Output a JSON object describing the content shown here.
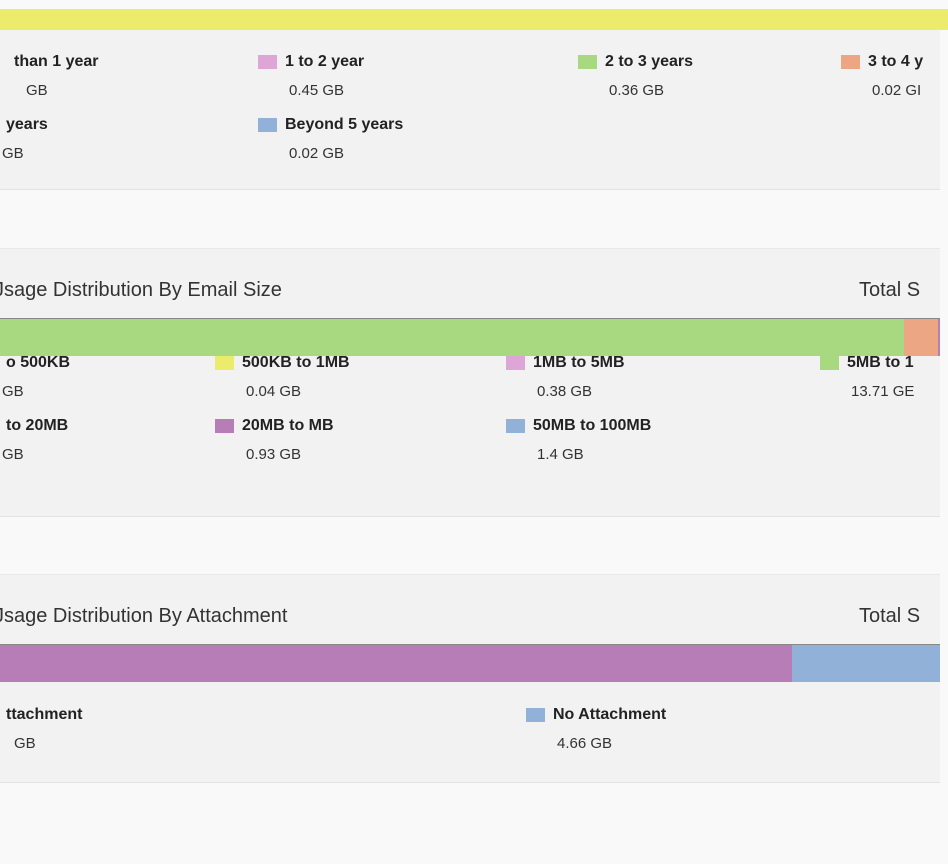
{
  "colors": {
    "yellow": "#ecec6c",
    "pink": "#dea6d6",
    "green": "#a8d880",
    "orange": "#eda684",
    "purple": "#b67db7",
    "blue": "#92b1d8"
  },
  "age_panel": {
    "legend": [
      {
        "label": "than 1 year",
        "value": "GB",
        "swatch": "none"
      },
      {
        "label": "1 to 2 year",
        "value": "0.45 GB",
        "swatch": "pink"
      },
      {
        "label": "2 to 3 years",
        "value": "0.36 GB",
        "swatch": "green"
      },
      {
        "label": "3 to 4 y",
        "value": "0.02 GI",
        "swatch": "orange"
      },
      {
        "label": "years",
        "value": "GB",
        "swatch": "none"
      },
      {
        "label": "Beyond 5 years",
        "value": "0.02 GB",
        "swatch": "blue"
      }
    ]
  },
  "size_panel": {
    "title": "Jsage Distribution By Email Size",
    "total_label": "Total S",
    "bar_segments": [
      {
        "color": "green",
        "fraction": 0.962
      },
      {
        "color": "orange",
        "fraction": 0.036
      },
      {
        "color": "purple",
        "fraction": 0.002
      }
    ],
    "legend": [
      {
        "label": "o 500KB",
        "value": "GB",
        "swatch": "none"
      },
      {
        "label": "500KB to 1MB",
        "value": "0.04 GB",
        "swatch": "yellow"
      },
      {
        "label": "1MB to 5MB",
        "value": "0.38 GB",
        "swatch": "pink"
      },
      {
        "label": "5MB to 1",
        "value": "13.71 GE",
        "swatch": "green"
      },
      {
        "label": "to 20MB",
        "value": "GB",
        "swatch": "none"
      },
      {
        "label": "20MB to MB",
        "value": "0.93 GB",
        "swatch": "purple"
      },
      {
        "label": "50MB to 100MB",
        "value": "1.4 GB",
        "swatch": "blue"
      }
    ]
  },
  "attachment_panel": {
    "title": "Jsage Distribution By Attachment",
    "total_label": "Total S",
    "bar_segments": [
      {
        "color": "purple",
        "fraction": 0.843
      },
      {
        "color": "blue",
        "fraction": 0.157
      }
    ],
    "legend": [
      {
        "label": "ttachment",
        "value": "GB",
        "swatch": "none"
      },
      {
        "label": "No Attachment",
        "value": "4.66 GB",
        "swatch": "blue"
      }
    ]
  }
}
